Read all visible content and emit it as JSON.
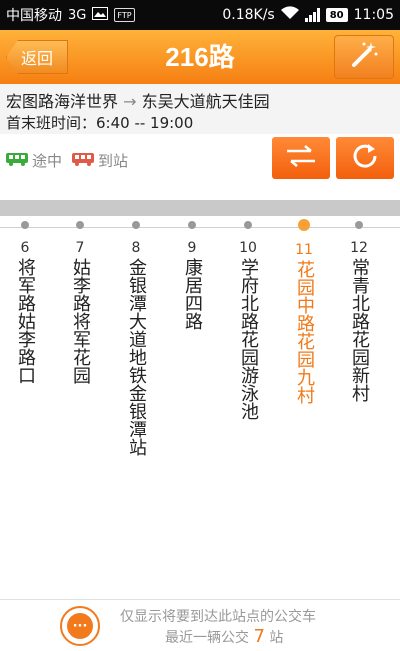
{
  "statusbar": {
    "carrier": "中国移动",
    "network": "3G",
    "speed": "0.18K/s",
    "battery": "80",
    "time": "11:05",
    "ftp_label": "FTP"
  },
  "header": {
    "back_label": "返回",
    "title": "216路"
  },
  "route": {
    "from": "宏图路海洋世界",
    "arrow": "→",
    "to": "东吴大道航天佳园",
    "schedule": "首末班时间：6:40 -- 19:00"
  },
  "legend": {
    "en_route": "途中",
    "arrived": "到站"
  },
  "stops": [
    {
      "num": "6",
      "name": "将军路姑李路口"
    },
    {
      "num": "7",
      "name": "姑李路将军花园"
    },
    {
      "num": "8",
      "name": "金银潭大道地铁金银潭站"
    },
    {
      "num": "9",
      "name": "康居四路"
    },
    {
      "num": "10",
      "name": "学府北路花园游泳池"
    },
    {
      "num": "11",
      "name": "花园中路花园九村",
      "active": true
    },
    {
      "num": "12",
      "name": "常青北路花园新村"
    }
  ],
  "footer": {
    "note1": "仅显示将要到达此站点的公交车",
    "note2_prefix": "最近一辆公交",
    "count": "7",
    "note2_suffix": "站",
    "chat_icon": "···"
  },
  "colors": {
    "accent": "#f57f12",
    "active": "#f07a1a",
    "green": "#3aab3a",
    "red": "#e05a4a"
  }
}
